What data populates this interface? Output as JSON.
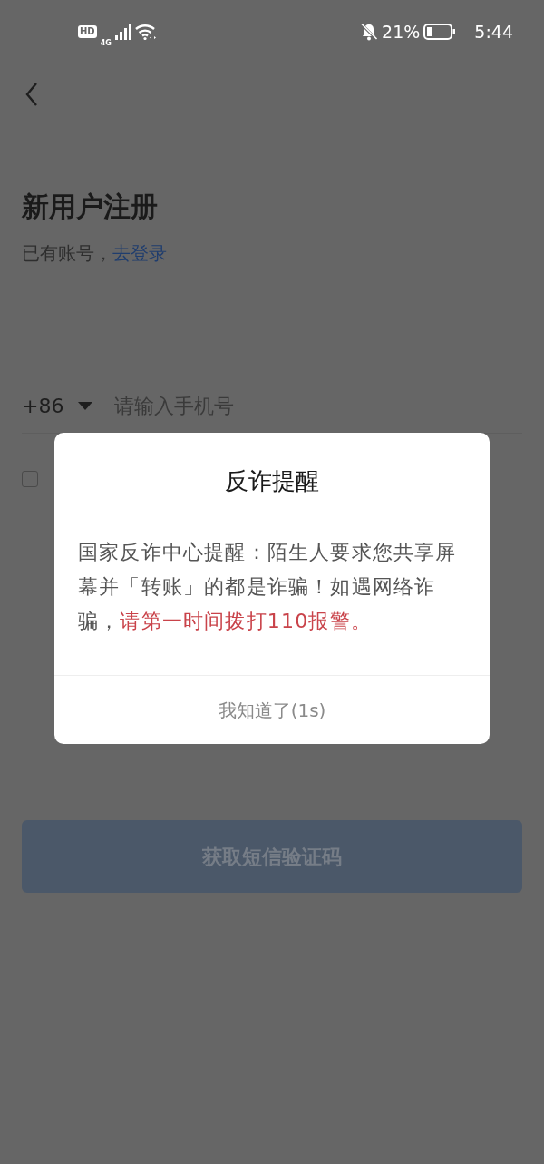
{
  "status_bar": {
    "hd": "HD",
    "network": "4G",
    "battery": "21%",
    "time": "5:44"
  },
  "page": {
    "title": "新用户注册",
    "subtitle": "已有账号，",
    "login_link": "去登录",
    "country_code": "+86",
    "phone_placeholder": "请输入手机号",
    "agreement_checked": false,
    "submit_button": "获取短信验证码",
    "submit_disabled": true
  },
  "dialog": {
    "title": "反诈提醒",
    "message": "国家反诈中心提醒：陌生人要求您共享屏幕并「转账」的都是诈骗！如遇网络诈骗，",
    "message_highlight": "请第一时间拨打110报警。",
    "button": "我知道了(1s)"
  }
}
